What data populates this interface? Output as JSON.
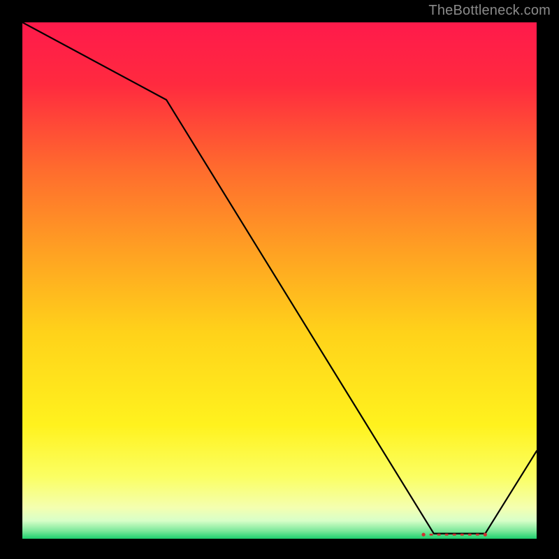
{
  "attribution": "TheBottleneck.com",
  "chart_data": {
    "type": "line",
    "title": "",
    "xlabel": "",
    "ylabel": "",
    "xlim": [
      0,
      100
    ],
    "ylim": [
      0,
      100
    ],
    "x": [
      0,
      28,
      80,
      90,
      100
    ],
    "values": [
      100,
      85,
      1,
      1,
      17
    ],
    "annotation": {
      "text_color": "#d03030",
      "x_range": [
        78,
        90
      ],
      "y": 0.8
    },
    "gradient_stops": [
      {
        "offset": 0.0,
        "color": "#ff1a4b"
      },
      {
        "offset": 0.12,
        "color": "#ff2a3f"
      },
      {
        "offset": 0.28,
        "color": "#ff6a2e"
      },
      {
        "offset": 0.45,
        "color": "#ffa322"
      },
      {
        "offset": 0.6,
        "color": "#ffd21a"
      },
      {
        "offset": 0.78,
        "color": "#fff21e"
      },
      {
        "offset": 0.88,
        "color": "#fbff63"
      },
      {
        "offset": 0.94,
        "color": "#f4ffb0"
      },
      {
        "offset": 0.965,
        "color": "#d8ffc8"
      },
      {
        "offset": 0.985,
        "color": "#7be89a"
      },
      {
        "offset": 1.0,
        "color": "#1ecf6e"
      }
    ]
  }
}
